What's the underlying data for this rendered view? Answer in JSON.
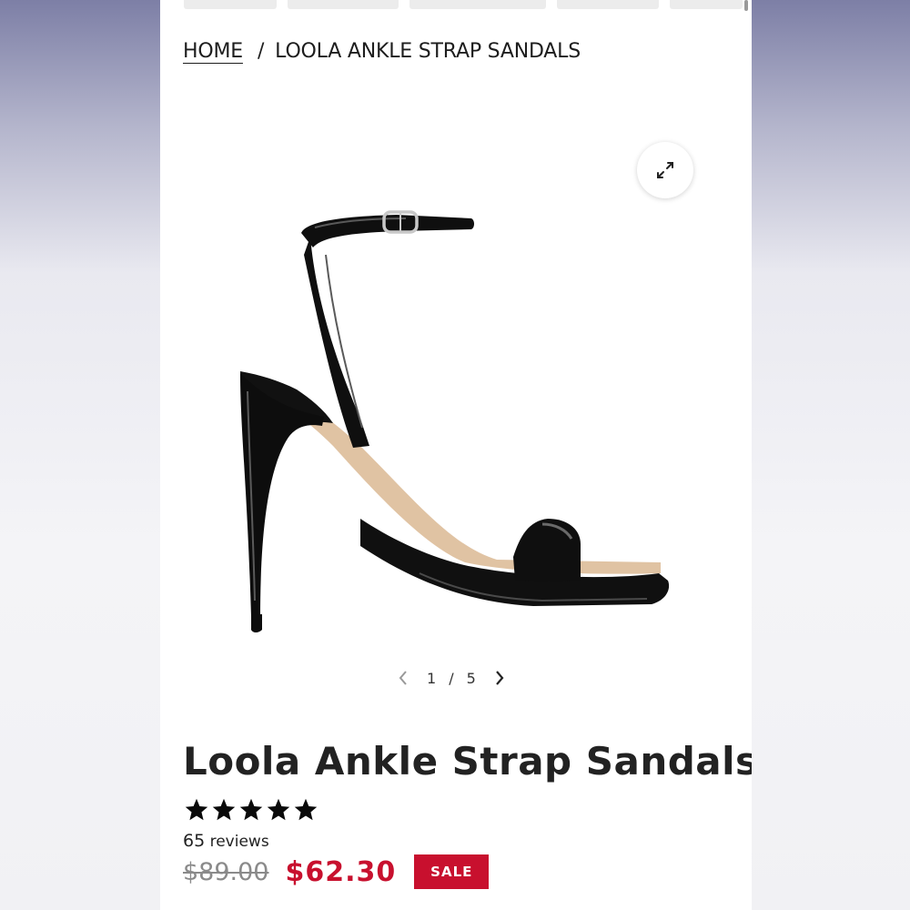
{
  "breadcrumb": {
    "home": "HOME",
    "separator": "/",
    "current": "LOOLA ANKLE STRAP SANDALS"
  },
  "gallery": {
    "current": "1",
    "separator": "/",
    "total": "5",
    "zoom_icon": "expand-icon",
    "prev_icon": "chevron-left-icon",
    "next_icon": "chevron-right-icon"
  },
  "product": {
    "title": "Loola Ankle Strap Sandals",
    "rating": 5,
    "rating_max": 5,
    "review_count": "65",
    "review_label": "reviews",
    "original_price": "$89.00",
    "sale_price": "$62.30",
    "badge": "SALE"
  },
  "colors": {
    "sale_red": "#c8102e",
    "text": "#222222",
    "muted": "#8a8a8a"
  }
}
